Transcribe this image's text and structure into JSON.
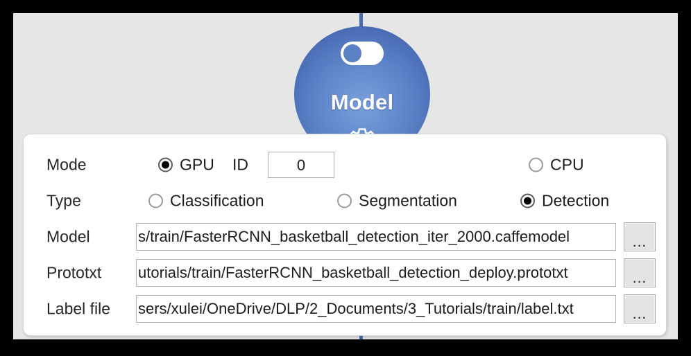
{
  "node": {
    "title": "Model",
    "toggle_state": "off",
    "gear_icon": "gear-icon",
    "toggle_icon": "toggle-switch-icon"
  },
  "colors": {
    "node_light": "#7ba0da",
    "node_dark": "#3d5da4",
    "connector": "#4a6cae",
    "panel_bg": "#e6e6e6",
    "card_bg": "#ffffff"
  },
  "form": {
    "rows": {
      "mode": {
        "label": "Mode",
        "gpu_label": "GPU",
        "cpu_label": "CPU",
        "id_label": "ID",
        "id_value": "0",
        "selected": "GPU"
      },
      "type": {
        "label": "Type",
        "classification_label": "Classification",
        "segmentation_label": "Segmentation",
        "detection_label": "Detection",
        "selected": "Detection"
      },
      "model": {
        "label": "Model",
        "value": "s/train/FasterRCNN_basketball_detection_iter_2000.caffemodel",
        "browse_label": "..."
      },
      "prototxt": {
        "label": "Prototxt",
        "value": "utorials/train/FasterRCNN_basketball_detection_deploy.prototxt",
        "browse_label": "..."
      },
      "label_file": {
        "label": "Label file",
        "value": "sers/xulei/OneDrive/DLP/2_Documents/3_Tutorials/train/label.txt",
        "browse_label": "..."
      }
    }
  }
}
